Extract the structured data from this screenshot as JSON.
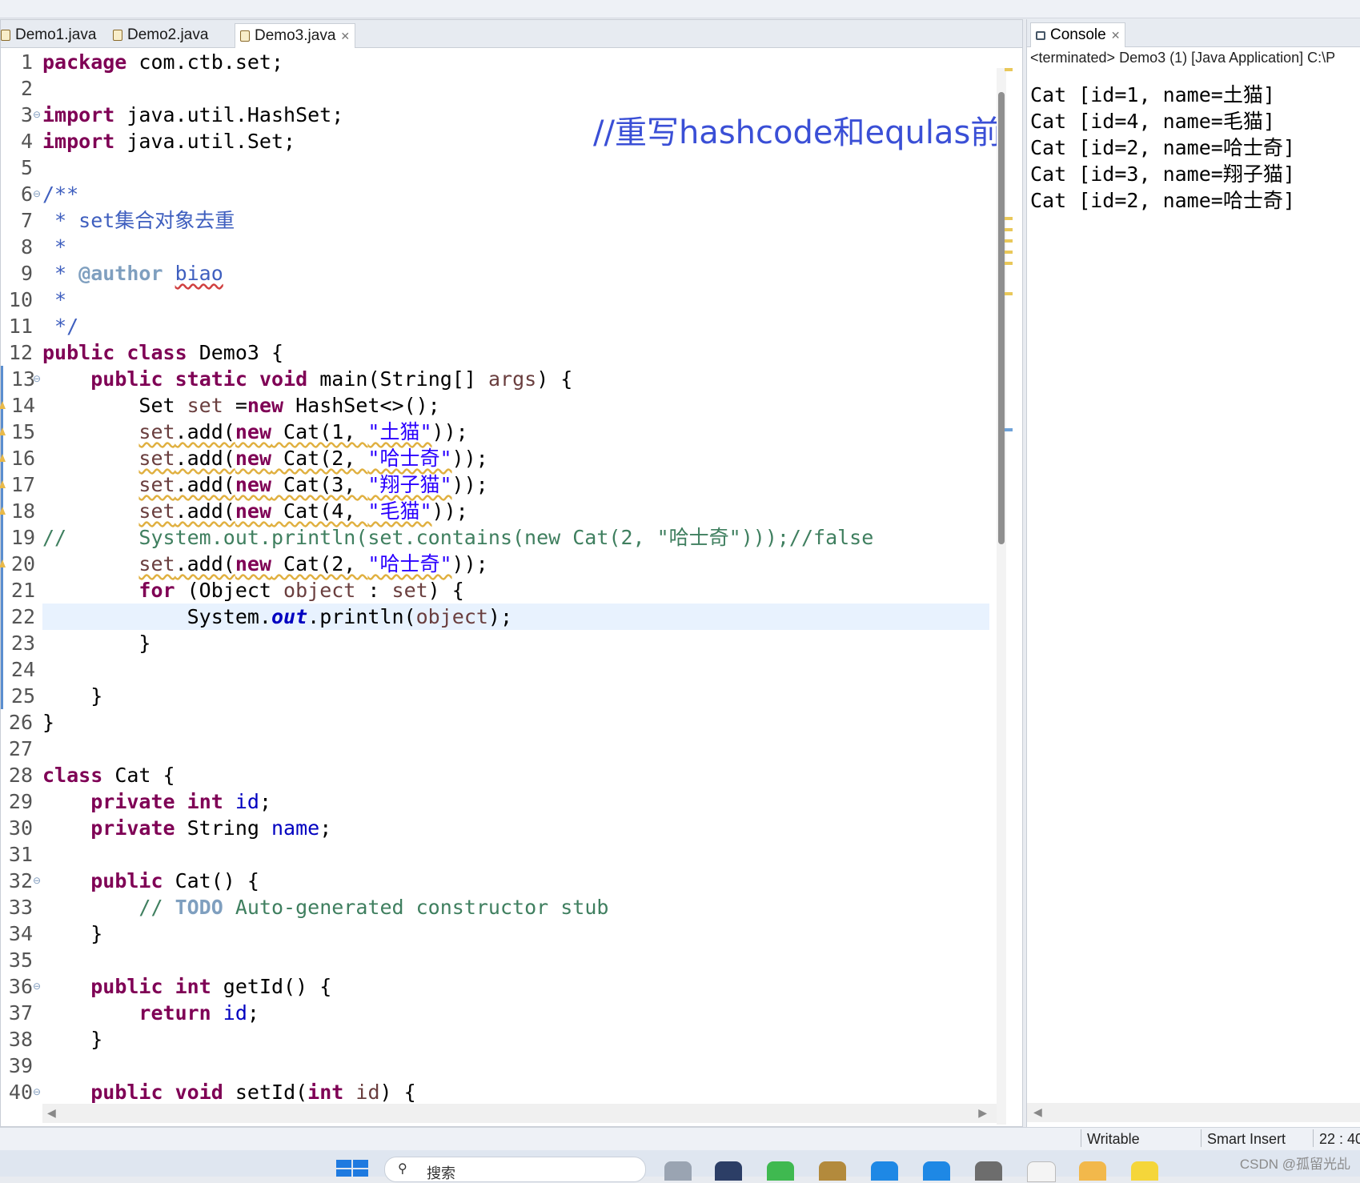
{
  "tabs": [
    {
      "label": "Demo1.java",
      "active": false
    },
    {
      "label": "Demo2.java",
      "active": false
    },
    {
      "label": "Demo3.java",
      "active": true
    }
  ],
  "annotation": "//重写hashcode和equlas前",
  "code_lines": [
    {
      "n": "1"
    },
    {
      "n": "2"
    },
    {
      "n": "3"
    },
    {
      "n": "4"
    },
    {
      "n": "5"
    },
    {
      "n": "6"
    },
    {
      "n": "7"
    },
    {
      "n": "8"
    },
    {
      "n": "9"
    },
    {
      "n": "10"
    },
    {
      "n": "11"
    },
    {
      "n": "12"
    },
    {
      "n": "13"
    },
    {
      "n": "14"
    },
    {
      "n": "15"
    },
    {
      "n": "16"
    },
    {
      "n": "17"
    },
    {
      "n": "18"
    },
    {
      "n": "19"
    },
    {
      "n": "20"
    },
    {
      "n": "21"
    },
    {
      "n": "22"
    },
    {
      "n": "23"
    },
    {
      "n": "24"
    },
    {
      "n": "25"
    },
    {
      "n": "26"
    },
    {
      "n": "27"
    },
    {
      "n": "28"
    },
    {
      "n": "29"
    },
    {
      "n": "30"
    },
    {
      "n": "31"
    },
    {
      "n": "32"
    },
    {
      "n": "33"
    },
    {
      "n": "34"
    },
    {
      "n": "35"
    },
    {
      "n": "36"
    },
    {
      "n": "37"
    },
    {
      "n": "38"
    },
    {
      "n": "39"
    },
    {
      "n": "40"
    }
  ],
  "code": {
    "l1": [
      "package",
      " com.ctb.set;"
    ],
    "l3": [
      "import",
      " java.util.HashSet;"
    ],
    "l4": [
      "import",
      " java.util.Set;"
    ],
    "l6": "/**",
    "l7": " * set集合对象去重",
    "l8": " *",
    "l9": [
      " * ",
      "@author",
      " ",
      "biao"
    ],
    "l10": " *",
    "l11": " */",
    "l12": [
      "public",
      " ",
      "class",
      " Demo3 {"
    ],
    "l13": [
      "    ",
      "public",
      " ",
      "static",
      " ",
      "void",
      " main(String[] ",
      "args",
      ") {"
    ],
    "l14": [
      "        Set ",
      "set",
      " =",
      "new",
      " HashSet<>();"
    ],
    "l15": [
      "        ",
      "set",
      ".add(",
      "new",
      " Cat(1, ",
      "\"土猫\"",
      "));"
    ],
    "l16": [
      "        ",
      "set",
      ".add(",
      "new",
      " Cat(2, ",
      "\"哈士奇\"",
      "));"
    ],
    "l17": [
      "        ",
      "set",
      ".add(",
      "new",
      " Cat(3, ",
      "\"翔子猫\"",
      "));"
    ],
    "l18": [
      "        ",
      "set",
      ".add(",
      "new",
      " Cat(4, ",
      "\"毛猫\"",
      "));"
    ],
    "l19": "//      System.out.println(set.contains(new Cat(2, \"哈士奇\")));//false",
    "l20": [
      "        ",
      "set",
      ".add(",
      "new",
      " Cat(2, ",
      "\"哈士奇\"",
      "));"
    ],
    "l21": [
      "        ",
      "for",
      " (Object ",
      "object",
      " : ",
      "set",
      ") {"
    ],
    "l22": [
      "            System.",
      "out",
      ".println(",
      "object",
      ");"
    ],
    "l23": "        }",
    "l25": "    }",
    "l26": "}",
    "l28": [
      "class",
      " Cat {"
    ],
    "l29": [
      "    ",
      "private",
      " ",
      "int",
      " ",
      "id",
      ";"
    ],
    "l30": [
      "    ",
      "private",
      " String ",
      "name",
      ";"
    ],
    "l32": [
      "    ",
      "public",
      " Cat() {"
    ],
    "l33": [
      "        // ",
      "TODO",
      " Auto-generated constructor stub"
    ],
    "l34": "    }",
    "l36": [
      "    ",
      "public",
      " ",
      "int",
      " getId() {"
    ],
    "l37": [
      "        ",
      "return",
      " ",
      "id",
      ";"
    ],
    "l38": "    }",
    "l40": [
      "    ",
      "public",
      " ",
      "void",
      " setId(",
      "int",
      " ",
      "id",
      ") {"
    ]
  },
  "console": {
    "tab_label": "Console",
    "status": "<terminated> Demo3 (1) [Java Application] C:\\P",
    "output": [
      "Cat [id=1, name=土猫]",
      "Cat [id=4, name=毛猫]",
      "Cat [id=2, name=哈士奇]",
      "Cat [id=3, name=翔子猫]",
      "Cat [id=2, name=哈士奇]"
    ]
  },
  "statusbar": {
    "writable": "Writable",
    "insert_mode": "Smart Insert",
    "position": "22 : 40"
  },
  "taskbar": {
    "search_placeholder": "搜索",
    "watermark": "CSDN @孤留光乩"
  },
  "colors": {
    "keyword": "#7f0055",
    "comment": "#3f7f5f",
    "javadoc": "#3f5fbf",
    "string": "#2a00ff",
    "field": "#0000c0",
    "annotation": "#3a4fd6",
    "current_line": "#e8f2fe"
  }
}
